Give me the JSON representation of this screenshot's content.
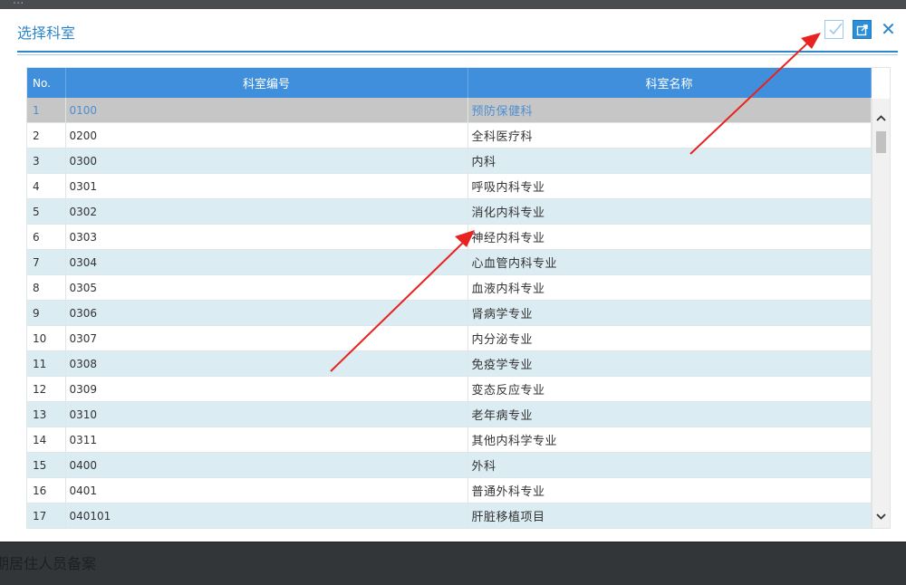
{
  "background": {
    "top_text": "...",
    "bottom_text": "期居住人员备案"
  },
  "dialog": {
    "title": "选择科室",
    "toolbar": {
      "confirm_icon": "check-box-icon",
      "open_icon": "external-open-icon",
      "close_icon": "close-icon",
      "close_glyph": "✕"
    },
    "colors": {
      "accent": "#2f86c9",
      "header_bg": "#3f8fdc",
      "row_alt": "#dcecf3",
      "row_selected": "#c6c6c6",
      "annotation_arrow": "#e8231f"
    }
  },
  "table": {
    "columns": {
      "no": "No.",
      "code": "科室编号",
      "name": "科室名称"
    },
    "selected_row": 1,
    "rows": [
      {
        "no": "1",
        "code": "0100",
        "name": "预防保健科"
      },
      {
        "no": "2",
        "code": "0200",
        "name": "全科医疗科"
      },
      {
        "no": "3",
        "code": "0300",
        "name": "内科"
      },
      {
        "no": "4",
        "code": "0301",
        "name": "呼吸内科专业"
      },
      {
        "no": "5",
        "code": "0302",
        "name": "消化内科专业"
      },
      {
        "no": "6",
        "code": "0303",
        "name": "神经内科专业"
      },
      {
        "no": "7",
        "code": "0304",
        "name": "心血管内科专业"
      },
      {
        "no": "8",
        "code": "0305",
        "name": "血液内科专业"
      },
      {
        "no": "9",
        "code": "0306",
        "name": "肾病学专业"
      },
      {
        "no": "10",
        "code": "0307",
        "name": "内分泌专业"
      },
      {
        "no": "11",
        "code": "0308",
        "name": "免疫学专业"
      },
      {
        "no": "12",
        "code": "0309",
        "name": "变态反应专业"
      },
      {
        "no": "13",
        "code": "0310",
        "name": "老年病专业"
      },
      {
        "no": "14",
        "code": "0311",
        "name": "其他内科学专业"
      },
      {
        "no": "15",
        "code": "0400",
        "name": "外科"
      },
      {
        "no": "16",
        "code": "0401",
        "name": "普通外科专业"
      },
      {
        "no": "17",
        "code": "040101",
        "name": "肝脏移植项目"
      }
    ],
    "scrollbar": {
      "up_icon": "chevron-up-icon",
      "down_icon": "chevron-down-icon"
    }
  }
}
